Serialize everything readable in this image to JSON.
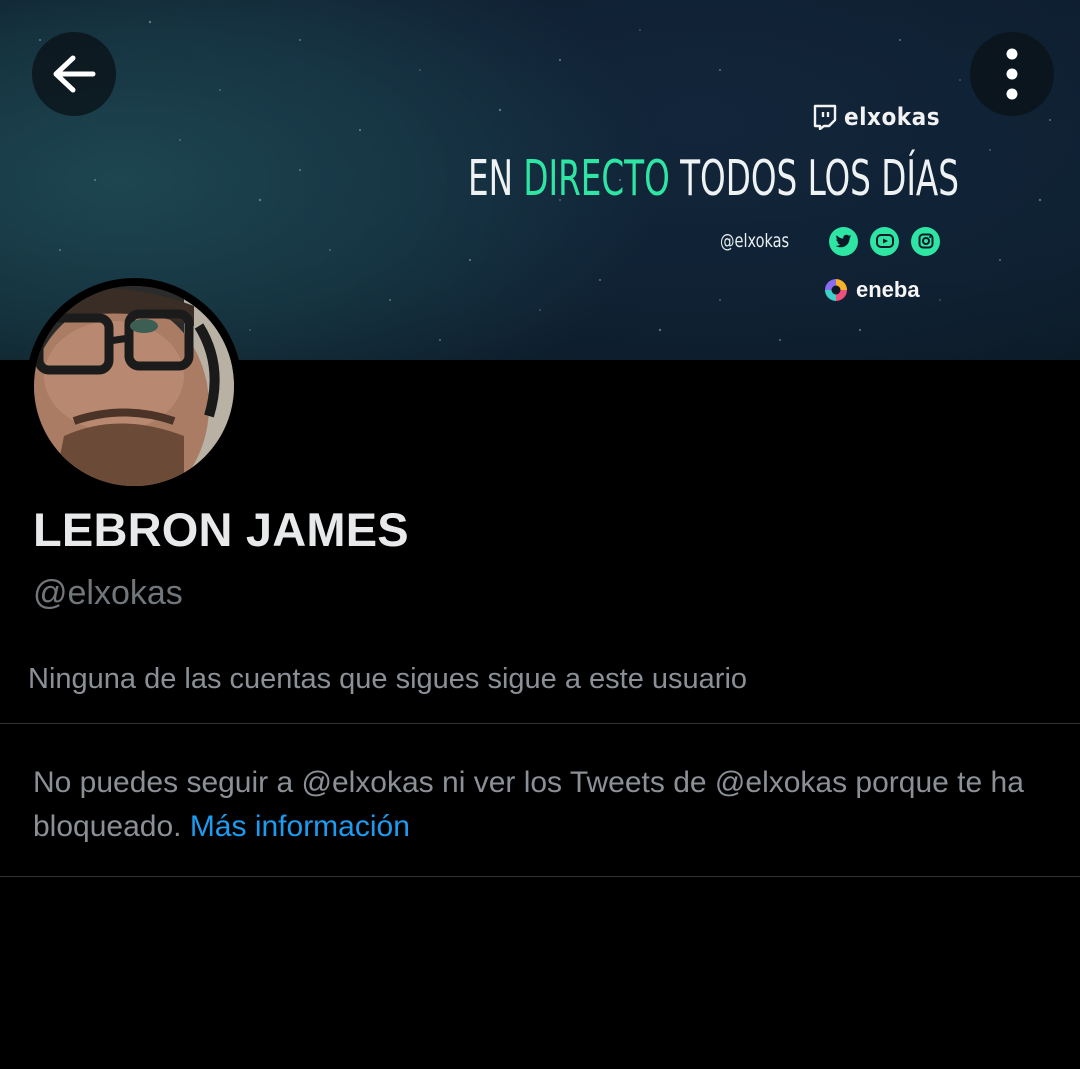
{
  "nav": {
    "back_icon": "arrow-left-icon",
    "more_icon": "more-vertical-icon"
  },
  "banner": {
    "brand_icon": "twitch-icon",
    "brand_name": "elxokas",
    "headline_part1": "EN ",
    "headline_highlight": "DIRECTO",
    "headline_part2": " TODOS LOS DÍAS",
    "social_handle": "@elxokas",
    "social_icons": [
      "twitter-icon",
      "youtube-icon",
      "instagram-icon"
    ],
    "sponsor_icon": "eneba-logo-icon",
    "sponsor_name": "eneba",
    "colors": {
      "highlight": "#2fe5a4"
    }
  },
  "profile": {
    "display_name": "LEBRON JAMES",
    "handle": "@elxokas",
    "followers_note": "Ninguna de las cuentas que sigues sigue a este usuario"
  },
  "blocked": {
    "message": "No puedes seguir a @elxokas ni ver los Tweets de @elxokas porque te ha bloqueado. ",
    "link_text": "Más información"
  },
  "colors": {
    "background": "#000000",
    "primary_text": "#e7e9ea",
    "secondary_text": "#71767b",
    "link": "#1d9bf0",
    "divider": "#2f3336"
  }
}
